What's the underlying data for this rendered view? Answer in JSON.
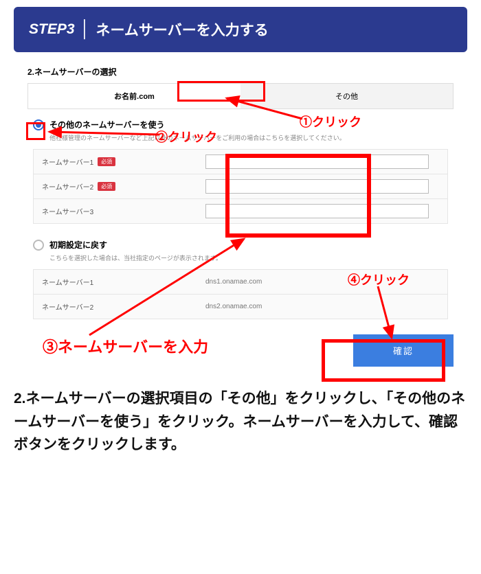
{
  "header": {
    "step": "STEP3",
    "title": "ネームサーバーを入力する"
  },
  "section_heading": "2.ネームサーバーの選択",
  "tabs": {
    "onamae": "お名前.com",
    "other": "その他"
  },
  "option_other": {
    "label": "その他のネームサーバーを使う",
    "note": "他社様管理のネームサーバーなど上記以外のネームサーバーをご利用の場合はこちらを選択してください。",
    "rows": {
      "ns1": "ネームサーバー1",
      "ns2": "ネームサーバー2",
      "ns3": "ネームサーバー3",
      "required": "必須"
    }
  },
  "option_reset": {
    "label": "初期設定に戻す",
    "note": "こちらを選択した場合は、当社指定のページが表示されます。",
    "rows": {
      "ns1_label": "ネームサーバー1",
      "ns1_value": "dns1.onamae.com",
      "ns2_label": "ネームサーバー2",
      "ns2_value": "dns2.onamae.com"
    }
  },
  "confirm_button": "確認",
  "annotations": {
    "a1": "①クリック",
    "a2": "②クリック",
    "a3": "③ネームサーバーを入力",
    "a4": "④クリック"
  },
  "description": "2.ネームサーバーの選択項目の「その他」をクリックし、「その他のネームサーバーを使う」をクリック。ネームサーバーを入力して、確認ボタンをクリックします。"
}
